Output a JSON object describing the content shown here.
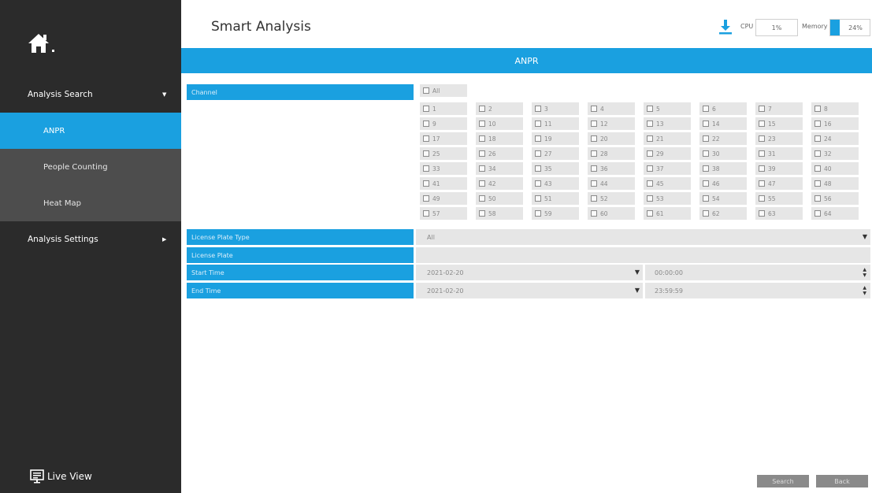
{
  "sidebar": {
    "analysis_search": "Analysis Search",
    "items": [
      {
        "label": "ANPR"
      },
      {
        "label": "People Counting"
      },
      {
        "label": "Heat Map"
      }
    ],
    "analysis_settings": "Analysis Settings",
    "live_view": "Live View"
  },
  "header": {
    "title": "Smart Analysis",
    "cpu_label": "CPU",
    "cpu_value": "1%",
    "memory_label": "Memory",
    "memory_value": "24%",
    "memory_fraction": 0.24
  },
  "banner": "ANPR",
  "form": {
    "channel_label": "Channel",
    "all_label": "All",
    "channels": [
      "1",
      "2",
      "3",
      "4",
      "5",
      "6",
      "7",
      "8",
      "9",
      "10",
      "11",
      "12",
      "13",
      "14",
      "15",
      "16",
      "17",
      "18",
      "19",
      "20",
      "21",
      "22",
      "23",
      "24",
      "25",
      "26",
      "27",
      "28",
      "29",
      "30",
      "31",
      "32",
      "33",
      "34",
      "35",
      "36",
      "37",
      "38",
      "39",
      "40",
      "41",
      "42",
      "43",
      "44",
      "45",
      "46",
      "47",
      "48",
      "49",
      "50",
      "51",
      "52",
      "53",
      "54",
      "55",
      "56",
      "57",
      "58",
      "59",
      "60",
      "61",
      "62",
      "63",
      "64"
    ],
    "plate_type_label": "License Plate Type",
    "plate_type_value": "All",
    "plate_label": "License Plate",
    "plate_value": "",
    "start_label": "Start Time",
    "start_date": "2021-02-20",
    "start_time": "00:00:00",
    "end_label": "End Time",
    "end_date": "2021-02-20",
    "end_time": "23:59:59"
  },
  "buttons": {
    "search": "Search",
    "back": "Back"
  },
  "colors": {
    "accent": "#1aa0e0",
    "sidebar": "#2b2b2b"
  }
}
